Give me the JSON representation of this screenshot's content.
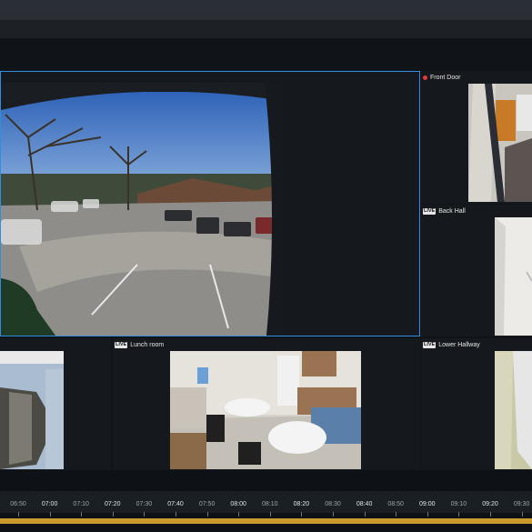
{
  "cameras": {
    "front_door": {
      "label": "Front Door",
      "recording": true
    },
    "back_hall": {
      "label": "Back Hall",
      "live": "LIVE"
    },
    "lunch_room": {
      "label": "Lunch room",
      "live": "LIVE"
    },
    "lower_hallway": {
      "label": "Lower Hallway",
      "live": "LIVE"
    }
  },
  "timeline": {
    "ticks": [
      {
        "label": "06:50",
        "major": false
      },
      {
        "label": "07:00",
        "major": true
      },
      {
        "label": "07:10",
        "major": false
      },
      {
        "label": "07:20",
        "major": true
      },
      {
        "label": "07:30",
        "major": false
      },
      {
        "label": "07:40",
        "major": true
      },
      {
        "label": "07:50",
        "major": false
      },
      {
        "label": "08:00",
        "major": true
      },
      {
        "label": "08:10",
        "major": false
      },
      {
        "label": "08:20",
        "major": true
      },
      {
        "label": "08:30",
        "major": false
      },
      {
        "label": "08:40",
        "major": true
      },
      {
        "label": "08:50",
        "major": false
      },
      {
        "label": "09:00",
        "major": true
      },
      {
        "label": "09:10",
        "major": false
      },
      {
        "label": "09:20",
        "major": true
      },
      {
        "label": "09:30",
        "major": false
      }
    ]
  },
  "colors": {
    "selection": "#2f8ee0",
    "recording_bar": "#c89b2c",
    "rec_dot": "#e23b3b"
  }
}
